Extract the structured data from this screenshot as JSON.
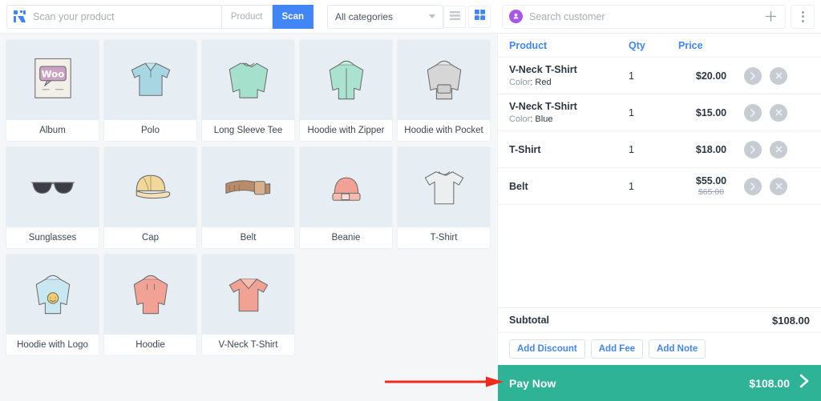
{
  "toolbar": {
    "scan_icon": "barcode-scanner-icon",
    "scan_placeholder": "Scan your product",
    "scan_value": "",
    "product_label": "Product",
    "scan_label": "Scan",
    "category_selected": "All categories",
    "list_view_icon": "list-view-icon",
    "grid_view_icon": "grid-view-icon",
    "active_view": "grid",
    "accent_blue": "#4285f4"
  },
  "customer": {
    "avatar_icon": "user-avatar-icon",
    "placeholder": "Search customer",
    "value": "",
    "add_icon": "plus-icon",
    "menu_icon": "kebab-menu-icon",
    "avatar_color": "#a855e8"
  },
  "products": [
    {
      "name": "Album",
      "art": "album"
    },
    {
      "name": "Polo",
      "art": "polo"
    },
    {
      "name": "Long Sleeve Tee",
      "art": "longsleeve"
    },
    {
      "name": "Hoodie with Zipper",
      "art": "hoodiezip"
    },
    {
      "name": "Hoodie with Pocket",
      "art": "hoodiepocket"
    },
    {
      "name": "Sunglasses",
      "art": "sunglasses"
    },
    {
      "name": "Cap",
      "art": "cap"
    },
    {
      "name": "Belt",
      "art": "belt"
    },
    {
      "name": "Beanie",
      "art": "beanie"
    },
    {
      "name": "T-Shirt",
      "art": "tshirt"
    },
    {
      "name": "Hoodie with Logo",
      "art": "hoodielogo"
    },
    {
      "name": "Hoodie",
      "art": "hoodie"
    },
    {
      "name": "V-Neck T-Shirt",
      "art": "vneck"
    }
  ],
  "cart": {
    "columns": {
      "product": "Product",
      "qty": "Qty",
      "price": "Price"
    },
    "items": [
      {
        "name": "V-Neck T-Shirt",
        "attr_label": "Color",
        "attr_value": "Red",
        "qty": "1",
        "price": "$20.00",
        "old_price": ""
      },
      {
        "name": "V-Neck T-Shirt",
        "attr_label": "Color",
        "attr_value": "Blue",
        "qty": "1",
        "price": "$15.00",
        "old_price": ""
      },
      {
        "name": "T-Shirt",
        "attr_label": "",
        "attr_value": "",
        "qty": "1",
        "price": "$18.00",
        "old_price": ""
      },
      {
        "name": "Belt",
        "attr_label": "",
        "attr_value": "",
        "qty": "1",
        "price": "$55.00",
        "old_price": "$65.00"
      }
    ],
    "expand_icon": "chevron-right-icon",
    "remove_icon": "close-circle-icon",
    "subtotal_label": "Subtotal",
    "subtotal_value": "$108.00",
    "add_discount_label": "Add Discount",
    "add_fee_label": "Add Fee",
    "add_note_label": "Add Note",
    "pay_now_label": "Pay Now",
    "pay_now_amount": "$108.00",
    "pay_now_icon": "chevron-right-icon",
    "pay_now_color": "#2eb396"
  },
  "annotation": {
    "arrow_icon": "red-arrow-icon",
    "color": "#f02b1d"
  }
}
